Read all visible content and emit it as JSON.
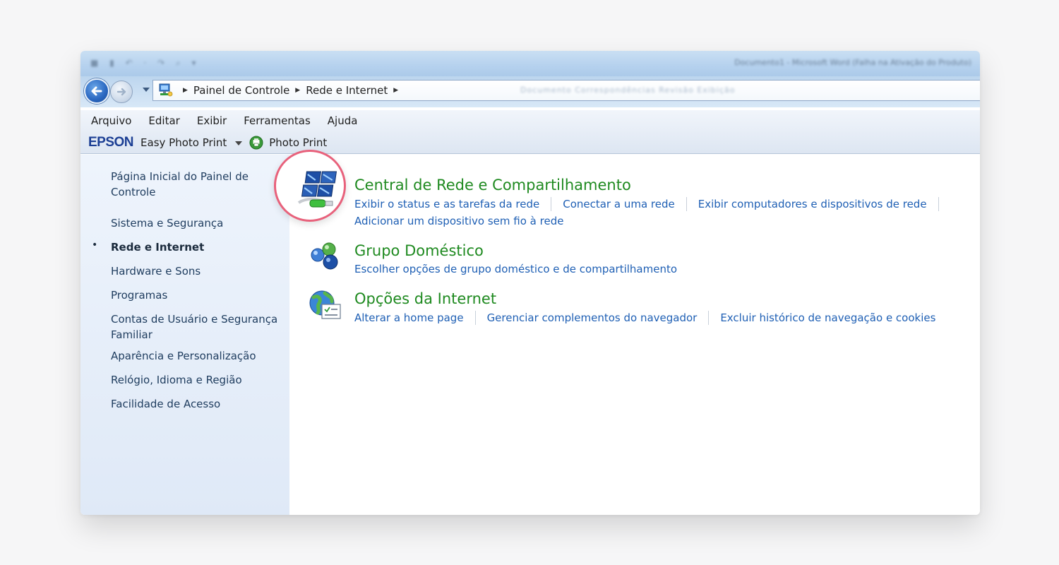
{
  "window": {
    "title_blurred": "Documento1 - Microsoft Word (Falha na Ativação do Produto)",
    "quick_access_blurred": "■ ▮ ↶ · ↷ ⌕ ▾"
  },
  "nav": {
    "breadcrumb": [
      "Painel de Controle",
      "Rede e Internet"
    ],
    "address_ghost": "Documento  Correspondências  Revisão  Exibição"
  },
  "menu": {
    "items": [
      "Arquivo",
      "Editar",
      "Exibir",
      "Ferramentas",
      "Ajuda"
    ]
  },
  "epson": {
    "logo": "EPSON",
    "app": "Easy Photo Print",
    "photo_print": "Photo Print"
  },
  "sidebar": {
    "items": [
      {
        "label": "Página Inicial do Painel de Controle",
        "active": false
      },
      {
        "label": "Sistema e Segurança",
        "active": false
      },
      {
        "label": "Rede e Internet",
        "active": true
      },
      {
        "label": "Hardware e Sons",
        "active": false
      },
      {
        "label": "Programas",
        "active": false
      },
      {
        "label": "Contas de Usuário e Segurança Familiar",
        "active": false
      },
      {
        "label": "Aparência e Personalização",
        "active": false
      },
      {
        "label": "Relógio, Idioma e Região",
        "active": false
      },
      {
        "label": "Facilidade de Acesso",
        "active": false
      }
    ],
    "bullet": "•"
  },
  "categories": [
    {
      "title": "Central de Rede e Compartilhamento",
      "icon": "network-sharing-center-icon",
      "links": [
        "Exibir o status e as tarefas da rede",
        "Conectar a uma rede",
        "Exibir computadores e dispositivos de rede",
        "Adicionar um dispositivo sem fio à rede"
      ]
    },
    {
      "title": "Grupo Doméstico",
      "icon": "homegroup-icon",
      "links": [
        "Escolher opções de grupo doméstico e de compartilhamento"
      ]
    },
    {
      "title": "Opções da Internet",
      "icon": "internet-options-icon",
      "links": [
        "Alterar a home page",
        "Gerenciar complementos do navegador",
        "Excluir histórico de navegação e cookies"
      ]
    }
  ],
  "colors": {
    "category_title": "#1f8a20",
    "task_link": "#1e5fb4",
    "highlight_ring": "#e8617b",
    "epson_brand": "#1c3f94"
  }
}
